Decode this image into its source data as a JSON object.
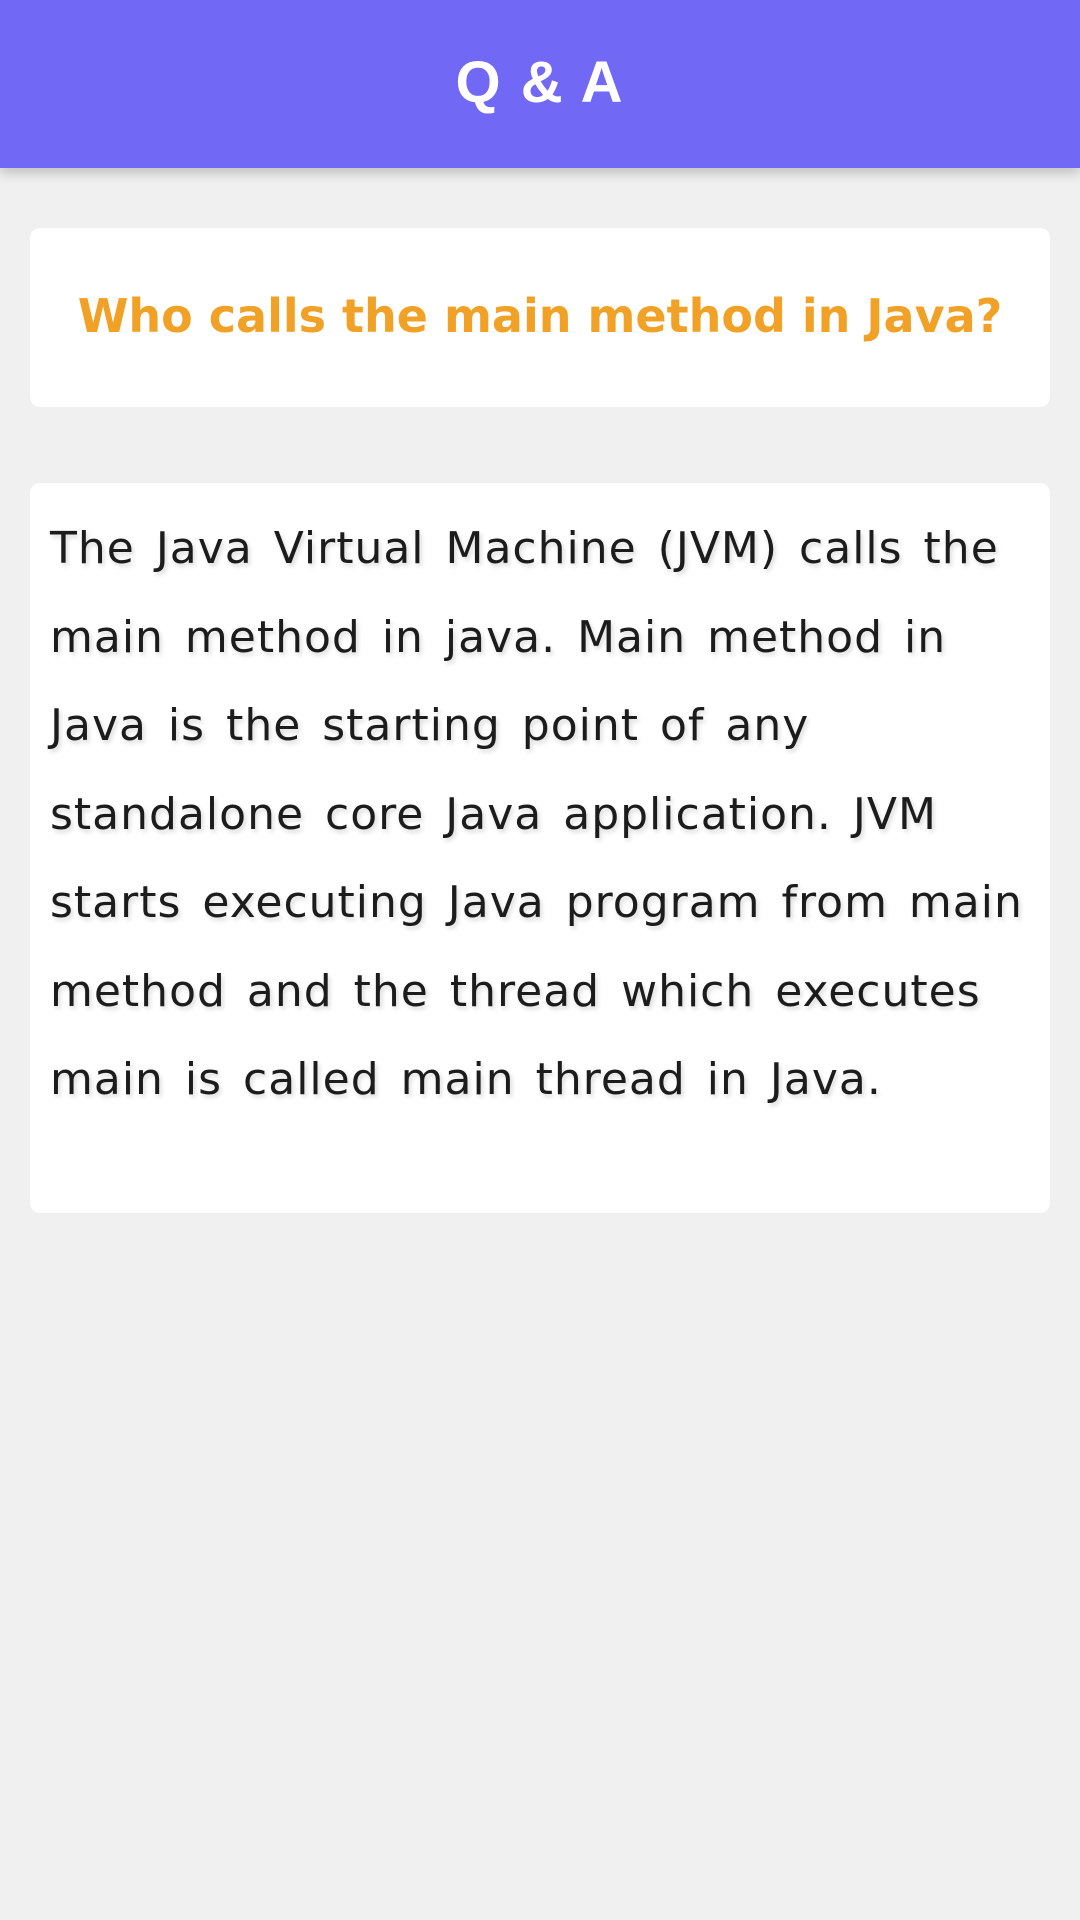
{
  "app_bar": {
    "title": "Q & A",
    "background_color": "#7169f6"
  },
  "question": {
    "text": "Who calls the main method in Java?",
    "color": "#f0a126"
  },
  "answer": {
    "text": "The Java Virtual Machine (JVM) calls the main method in java. Main method in Java is the starting point of any standalone core Java application. JVM starts executing Java program from main method and the thread which executes main is called main thread in Java."
  }
}
